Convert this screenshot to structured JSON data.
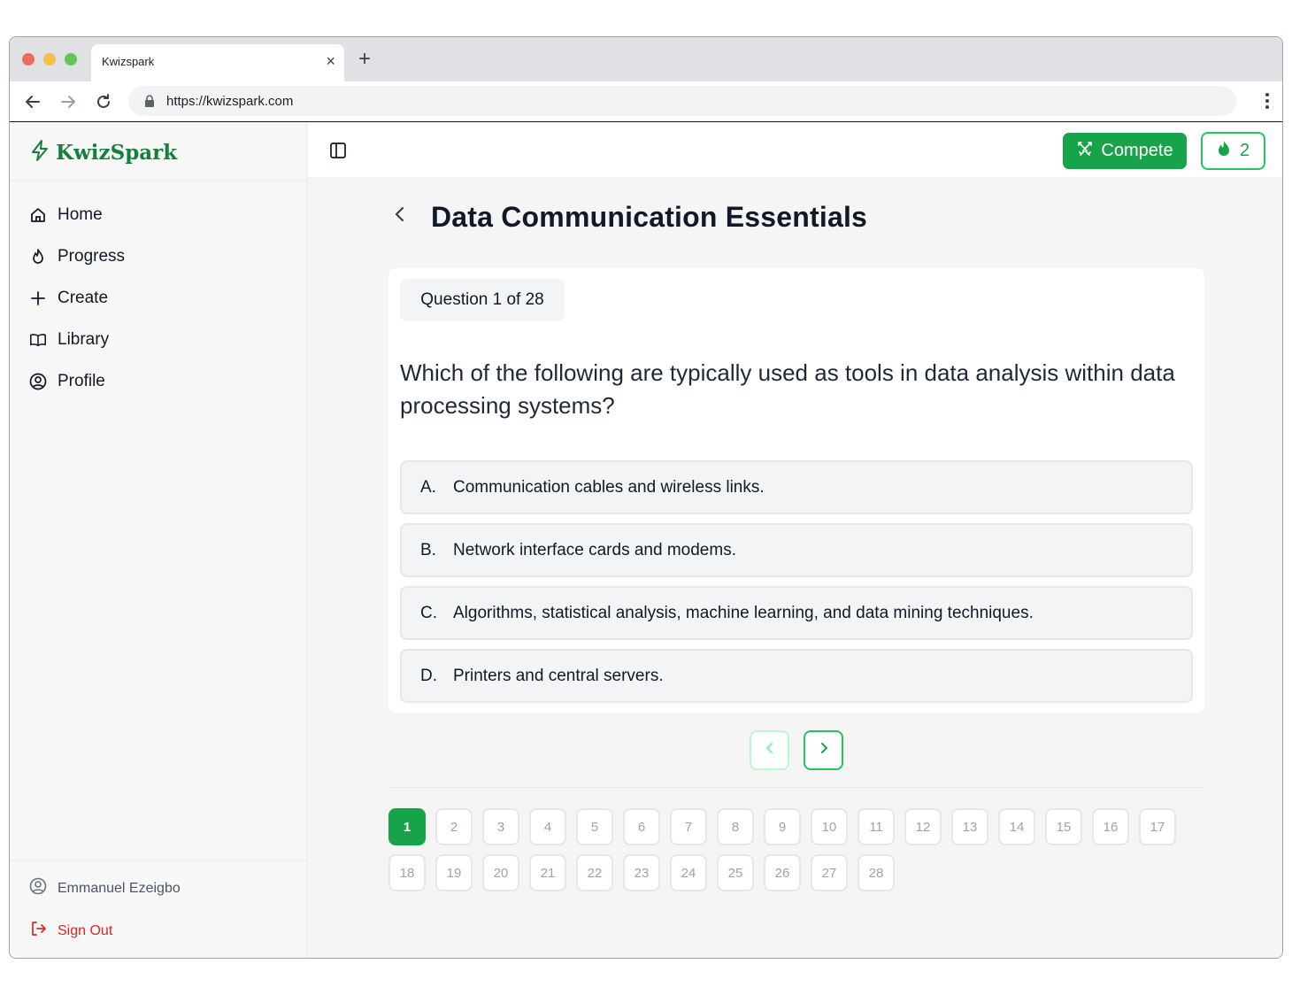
{
  "browser": {
    "tab_title": "Kwizspark",
    "tab_close": "×",
    "new_tab": "+",
    "url": "https://kwizspark.com"
  },
  "sidebar": {
    "brand": "KwizSpark",
    "items": [
      {
        "label": "Home",
        "icon": "home-icon"
      },
      {
        "label": "Progress",
        "icon": "flame-icon"
      },
      {
        "label": "Create",
        "icon": "plus-icon"
      },
      {
        "label": "Library",
        "icon": "book-icon"
      },
      {
        "label": "Profile",
        "icon": "user-circle-icon"
      }
    ],
    "user_name": "Emmanuel Ezeigbo",
    "sign_out": "Sign Out"
  },
  "topbar": {
    "compete_label": "Compete",
    "streak_count": "2"
  },
  "quiz": {
    "title": "Data Communication Essentials",
    "progress_label": "Question 1 of 28",
    "question": "Which of the following are typically used as tools in data analysis within data processing systems?",
    "options": [
      {
        "letter": "A.",
        "text": "Communication cables and wireless links."
      },
      {
        "letter": "B.",
        "text": "Network interface cards and modems."
      },
      {
        "letter": "C.",
        "text": "Algorithms, statistical analysis, machine learning, and data mining techniques."
      },
      {
        "letter": "D.",
        "text": "Printers and central servers."
      }
    ],
    "current_question": 1,
    "question_numbers": [
      "1",
      "2",
      "3",
      "4",
      "5",
      "6",
      "7",
      "8",
      "9",
      "10",
      "11",
      "12",
      "13",
      "14",
      "15",
      "16",
      "17",
      "18",
      "19",
      "20",
      "21",
      "22",
      "23",
      "24",
      "25",
      "26",
      "27",
      "28"
    ]
  },
  "colors": {
    "brand": "#15803d",
    "accent": "#16a34a",
    "danger": "#dc2626"
  }
}
